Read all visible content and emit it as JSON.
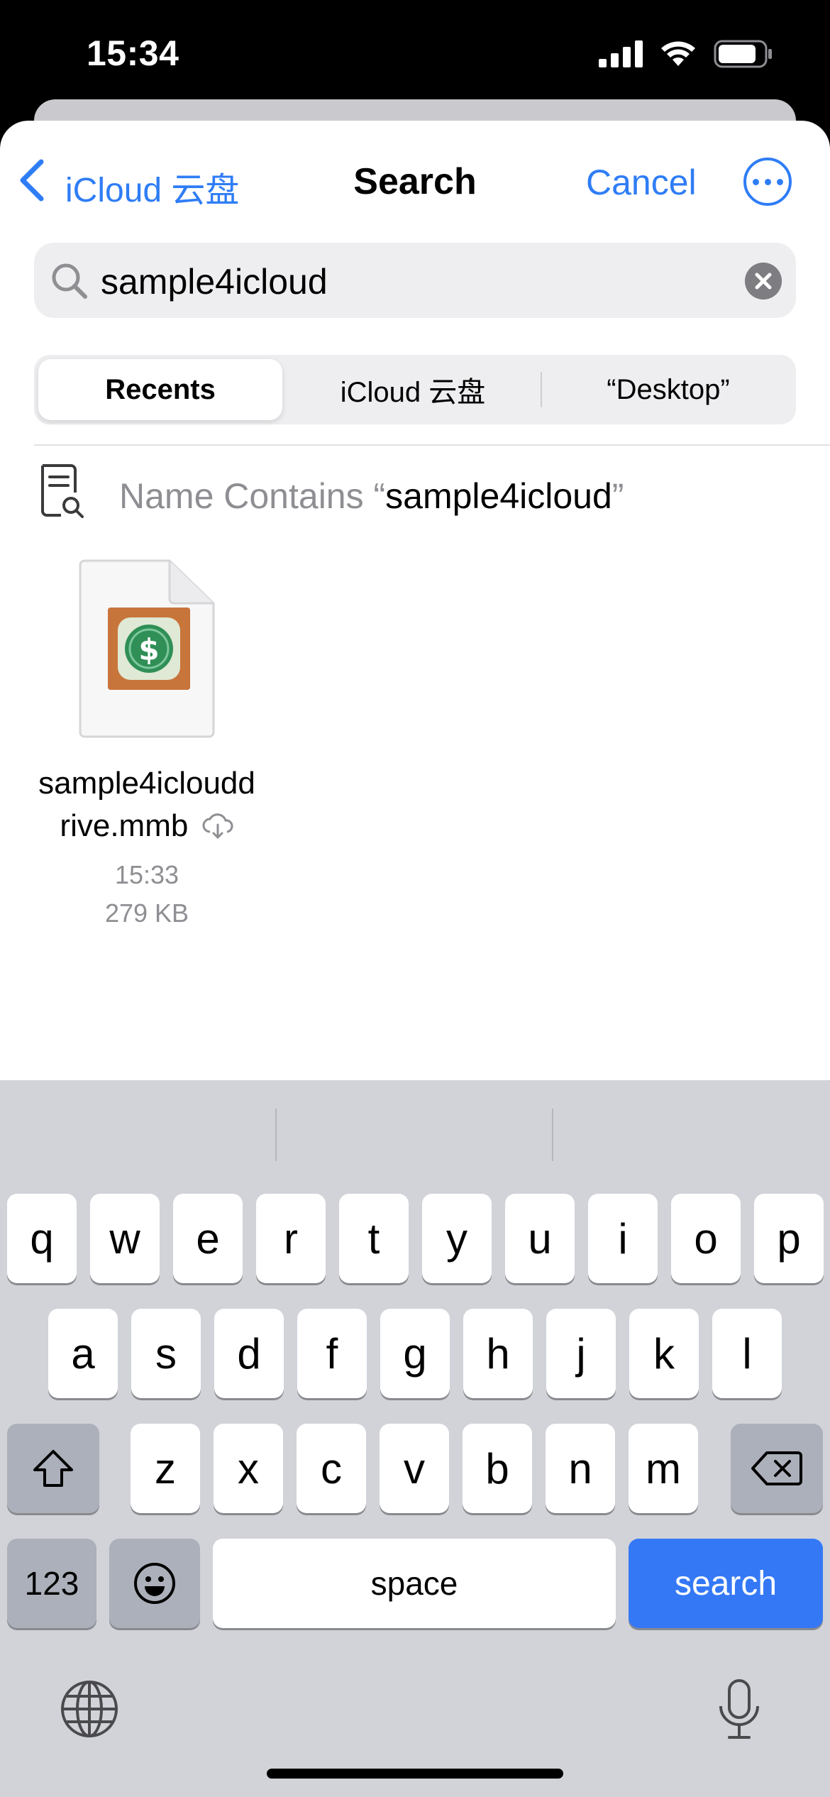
{
  "status_bar": {
    "time": "15:34"
  },
  "nav": {
    "back_label": "iCloud 云盘",
    "title": "Search",
    "cancel_label": "Cancel"
  },
  "search": {
    "value": "sample4icloud"
  },
  "segments": [
    {
      "label": "Recents",
      "selected": true
    },
    {
      "label": "iCloud 云盘",
      "selected": false
    },
    {
      "label": "“Desktop”",
      "selected": false
    }
  ],
  "suggestion": {
    "prefix": "Name Contains “",
    "term": "sample4icloud",
    "suffix": "”"
  },
  "file": {
    "name_line1": "sample4icloudd",
    "name_line2": "rive.mmb",
    "time": "15:33",
    "size": "279 KB",
    "icon": "money-app-icon",
    "status_icon": "cloud-download-icon"
  },
  "keyboard": {
    "row1": [
      "q",
      "w",
      "e",
      "r",
      "t",
      "y",
      "u",
      "i",
      "o",
      "p"
    ],
    "row2": [
      "a",
      "s",
      "d",
      "f",
      "g",
      "h",
      "j",
      "k",
      "l"
    ],
    "row3": [
      "z",
      "x",
      "c",
      "v",
      "b",
      "n",
      "m"
    ],
    "numbers_label": "123",
    "space_label": "space",
    "search_label": "search"
  },
  "colors": {
    "accent": "#2f7df6",
    "search_key": "#3478f6",
    "keyboard_bg": "#d1d3d9"
  }
}
